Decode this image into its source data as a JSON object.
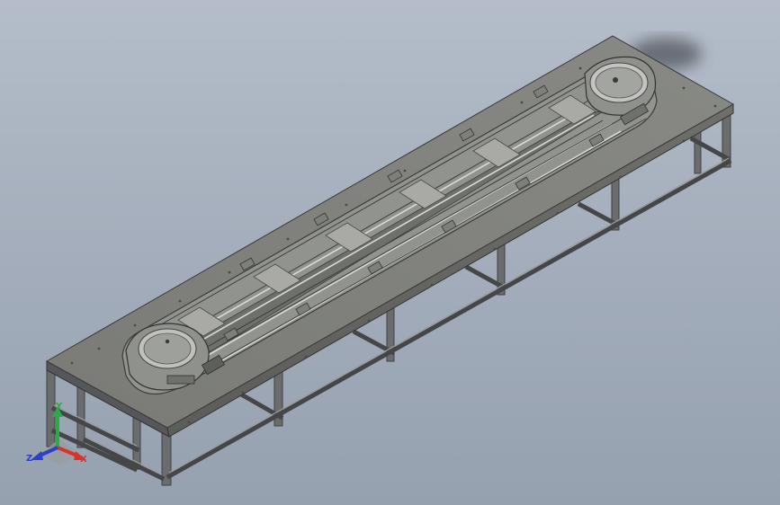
{
  "viewport": {
    "background_top": "#b4bdc9",
    "background_bottom": "#96a1b0"
  },
  "model": {
    "table_top_color": "#7c7d78",
    "frame_color": "#5a5c5e",
    "conveyor_color": "#8d8f8c",
    "pulley_color": "#9a9b97"
  },
  "triad": {
    "x_label": "X",
    "y_label": "Y",
    "z_label": "Z",
    "x_color": "#d8342b",
    "y_color": "#2fa84a",
    "z_color": "#2a42c9"
  }
}
